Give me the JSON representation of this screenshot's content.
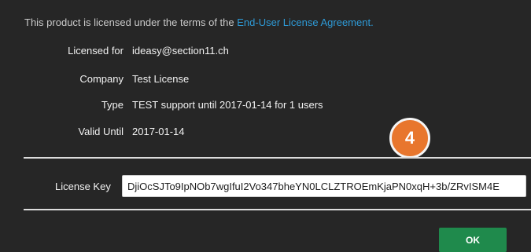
{
  "intro": {
    "text": "This product is licensed under the terms of the",
    "link": "End-User License Agreement."
  },
  "license_info": [
    {
      "label": "Licensed for",
      "value": "ideasy@section11.ch"
    },
    {
      "label": "Company",
      "value": "Test License"
    },
    {
      "label": "Type",
      "value": "TEST support until 2017-01-14 for 1 users"
    },
    {
      "label": "Valid Until",
      "value": "2017-01-14"
    }
  ],
  "license_key": {
    "label": "License Key",
    "value": "DjiOcSJTo9IpNOb7wgIfuI2Vo347bheYN0LCLZTROEmKjaPN0xqH+3b/ZRvISM4E"
  },
  "badge": {
    "number": "4",
    "color": "#e8762d"
  },
  "actions": {
    "ok_label": "OK",
    "ok_color": "#1f8a4c"
  },
  "colors": {
    "link": "#2e9ad6",
    "background": "#262626"
  }
}
